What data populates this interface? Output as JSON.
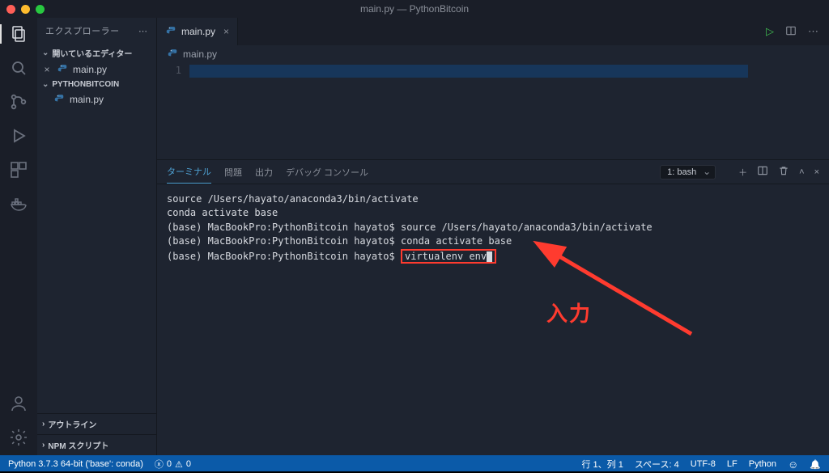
{
  "window": {
    "title": "main.py — PythonBitcoin"
  },
  "sidebar": {
    "title": "エクスプローラー",
    "open_editors_label": "開いているエディター",
    "open_editors": [
      {
        "name": "main.py"
      }
    ],
    "folder_label": "PYTHONBITCOIN",
    "files": [
      {
        "name": "main.py"
      }
    ],
    "outline_label": "アウトライン",
    "npm_label": "NPM スクリプト"
  },
  "tabs": [
    {
      "label": "main.py"
    }
  ],
  "breadcrumb": {
    "file": "main.py"
  },
  "editor": {
    "line_number": "1"
  },
  "panel": {
    "tabs": {
      "terminal": "ターミナル",
      "problems": "問題",
      "output": "出力",
      "debug": "デバッグ コンソール"
    },
    "shell_selector": "1: bash",
    "lines": [
      "source /Users/hayato/anaconda3/bin/activate",
      "conda activate base",
      "(base) MacBookPro:PythonBitcoin hayato$ source /Users/hayato/anaconda3/bin/activate",
      "(base) MacBookPro:PythonBitcoin hayato$ conda activate base",
      "(base) MacBookPro:PythonBitcoin hayato$ "
    ],
    "current_cmd": "virtualenv env",
    "annotation": "入力"
  },
  "status": {
    "python": "Python 3.7.3 64-bit ('base': conda)",
    "errors": "0",
    "warnings": "0",
    "line_col": "行 1、列 1",
    "spaces": "スペース: 4",
    "encoding": "UTF-8",
    "eol": "LF",
    "lang": "Python"
  },
  "icons": {
    "explorer": "explorer",
    "search": "search",
    "scm": "scm",
    "debug": "debug",
    "extensions": "extensions",
    "docker": "docker",
    "account": "account",
    "settings": "settings"
  }
}
